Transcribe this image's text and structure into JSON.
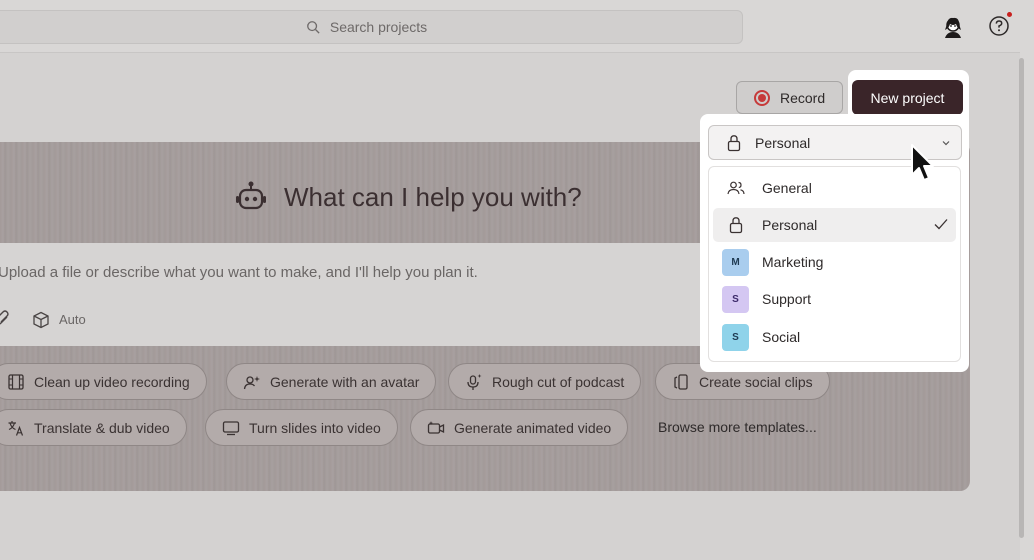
{
  "topbar": {
    "search_placeholder": "Search projects",
    "search_icon": "search-icon",
    "avatar_icon": "user-avatar",
    "help_icon": "help-icon",
    "notification_color": "#c8201e"
  },
  "actions": {
    "record_label": "Record",
    "new_project_label": "New project",
    "record_color": "#c63a3a",
    "new_project_color": "#3a2529"
  },
  "hero": {
    "title": "What can I help you with?",
    "title_icon": "robot-icon",
    "prompt_placeholder": "Upload a file or describe what you want to make, and I'll help you plan it.",
    "model_label": "Auto",
    "chips": [
      {
        "label": "Clean up video recording",
        "icon": "film-icon"
      },
      {
        "label": "Generate with an avatar",
        "icon": "avatar-sparkle-icon"
      },
      {
        "label": "Rough cut of podcast",
        "icon": "mic-sparkle-icon"
      },
      {
        "label": "Create social clips",
        "icon": "phone-clips-icon"
      },
      {
        "label": "Translate & dub video",
        "icon": "translate-icon"
      },
      {
        "label": "Turn slides into video",
        "icon": "monitor-icon"
      },
      {
        "label": "Generate animated video",
        "icon": "animated-video-icon"
      }
    ],
    "browse_label": "Browse more templates..."
  },
  "dropdown": {
    "selected_label": "Personal",
    "items": [
      {
        "label": "General",
        "icon": "users-icon"
      },
      {
        "label": "Personal",
        "icon": "lock-icon",
        "selected": true
      },
      {
        "label": "Marketing",
        "badge": "M",
        "badge_color": "#a9cdee"
      },
      {
        "label": "Support",
        "badge": "S",
        "badge_color": "#d4c7f2"
      },
      {
        "label": "Social",
        "badge": "S",
        "badge_color": "#8fd3ea"
      }
    ]
  }
}
